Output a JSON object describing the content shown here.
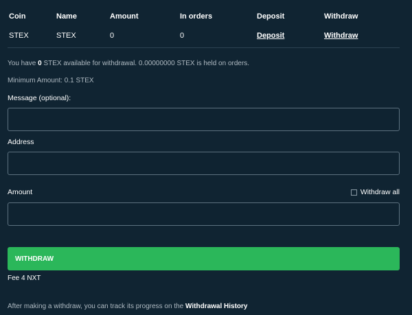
{
  "table": {
    "headers": {
      "coin": "Coin",
      "name": "Name",
      "amount": "Amount",
      "in_orders": "In orders",
      "deposit": "Deposit",
      "withdraw": "Withdraw"
    },
    "row": {
      "coin": "STEX",
      "name": "STEX",
      "amount": "0",
      "in_orders": "0",
      "deposit_link": "Deposit",
      "withdraw_link": "Withdraw"
    }
  },
  "info": {
    "prefix": "You have ",
    "available": "0",
    "suffix": " STEX available for withdrawal. 0.00000000 STEX is held on orders."
  },
  "min_amount": "Minimum Amount: 0.1 STEX",
  "form": {
    "message_label": "Message (optional):",
    "message_value": "",
    "address_label": "Address",
    "address_value": "",
    "amount_label": "Amount",
    "amount_value": "",
    "withdraw_all_label": "Withdraw all",
    "withdraw_all_checked": false,
    "submit_label": "WITHDRAW",
    "fee": "Fee 4 NXT"
  },
  "footer": {
    "text": "After making a withdraw, you can track its progress on the ",
    "link": "Withdrawal History"
  },
  "colors": {
    "background": "#102432",
    "accent_green": "#2bb75a",
    "border": "#5d7280"
  }
}
